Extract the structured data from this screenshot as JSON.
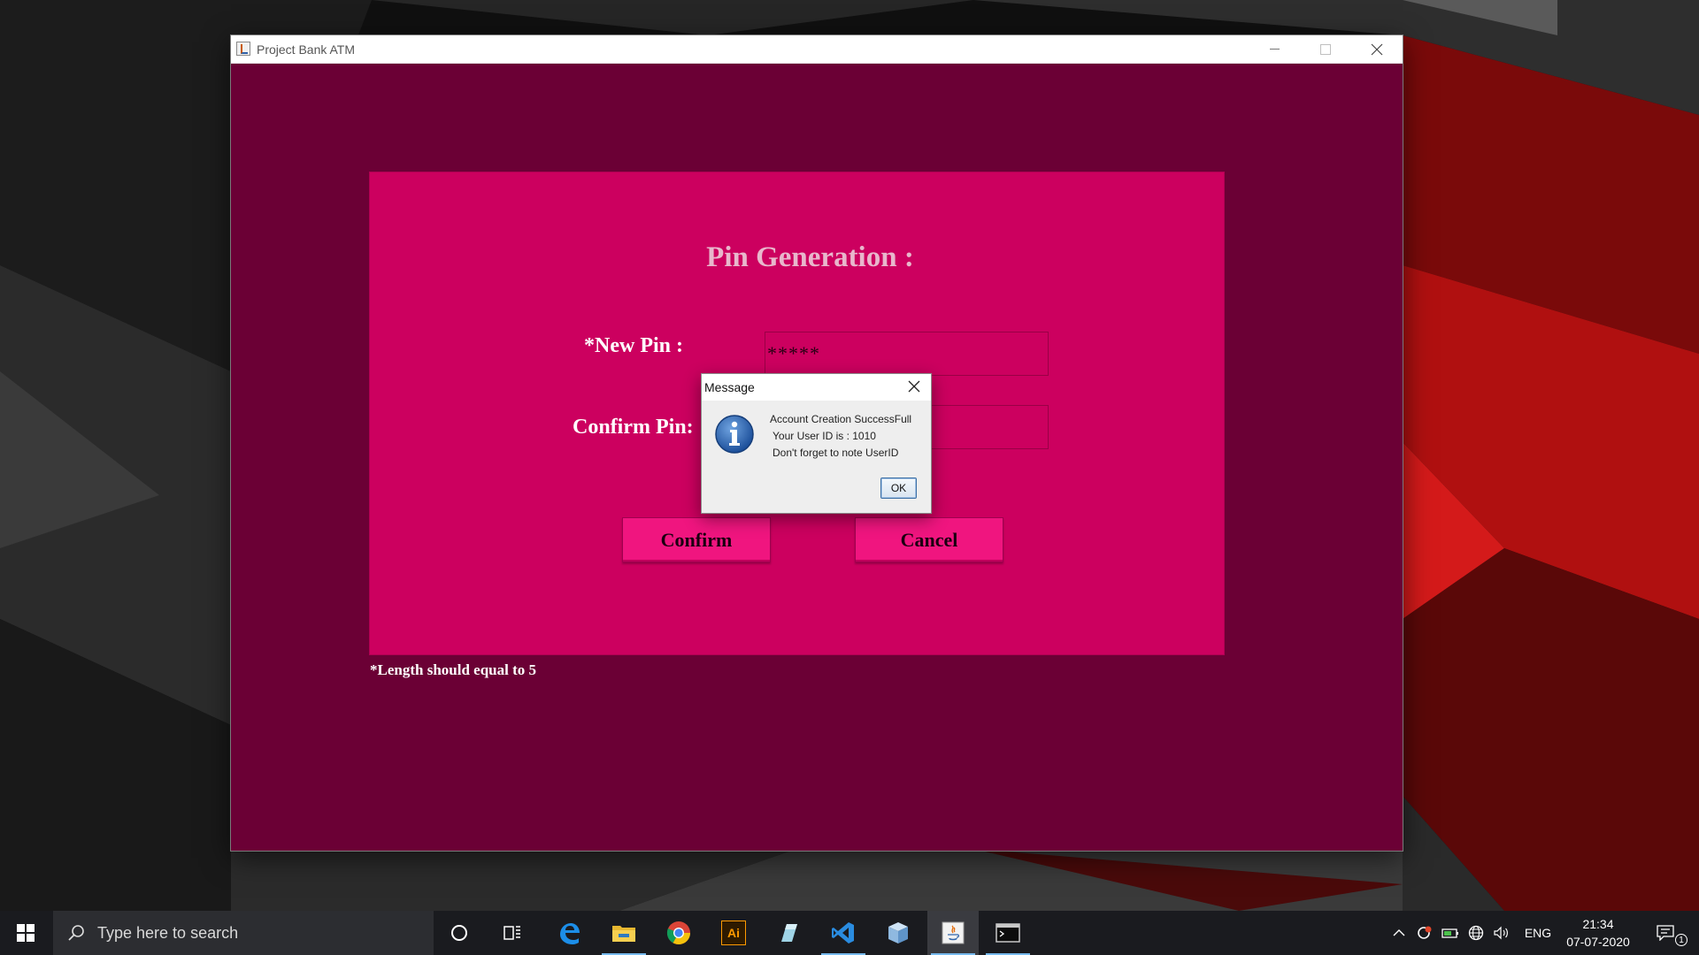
{
  "window": {
    "title": "Project Bank ATM",
    "controls": [
      "minimize",
      "maximize",
      "close"
    ]
  },
  "form": {
    "heading": "Pin Generation :",
    "new_pin_label": "*New Pin :",
    "new_pin_value": "*****",
    "confirm_pin_label": "Confirm Pin:",
    "confirm_pin_value": "",
    "confirm_button": "Confirm",
    "cancel_button": "Cancel",
    "note": "*Length  should equal to 5"
  },
  "dialog": {
    "title": "Message",
    "line1": "Account Creation SuccessFull",
    "line2": "Your User ID is : 1010",
    "line3": "Don't forget to note UserID",
    "ok_button": "OK",
    "icon": "info-icon"
  },
  "taskbar": {
    "search_placeholder": "Type here to search",
    "pinned": [
      "cortana-icon",
      "task-view-icon",
      "edge-icon",
      "file-explorer-icon",
      "chrome-icon",
      "illustrator-icon",
      "app-icon",
      "vscode-icon",
      "box-icon",
      "java-icon",
      "terminal-icon"
    ],
    "illustrator_label": "Ai",
    "language": "ENG",
    "time": "21:34",
    "date": "07-07-2020",
    "notification_count": "1"
  },
  "colors": {
    "window_bg": "#6b0035",
    "panel_bg": "#cc005f",
    "button_bg": "#f0157f",
    "heading": "#e8b7cc"
  }
}
